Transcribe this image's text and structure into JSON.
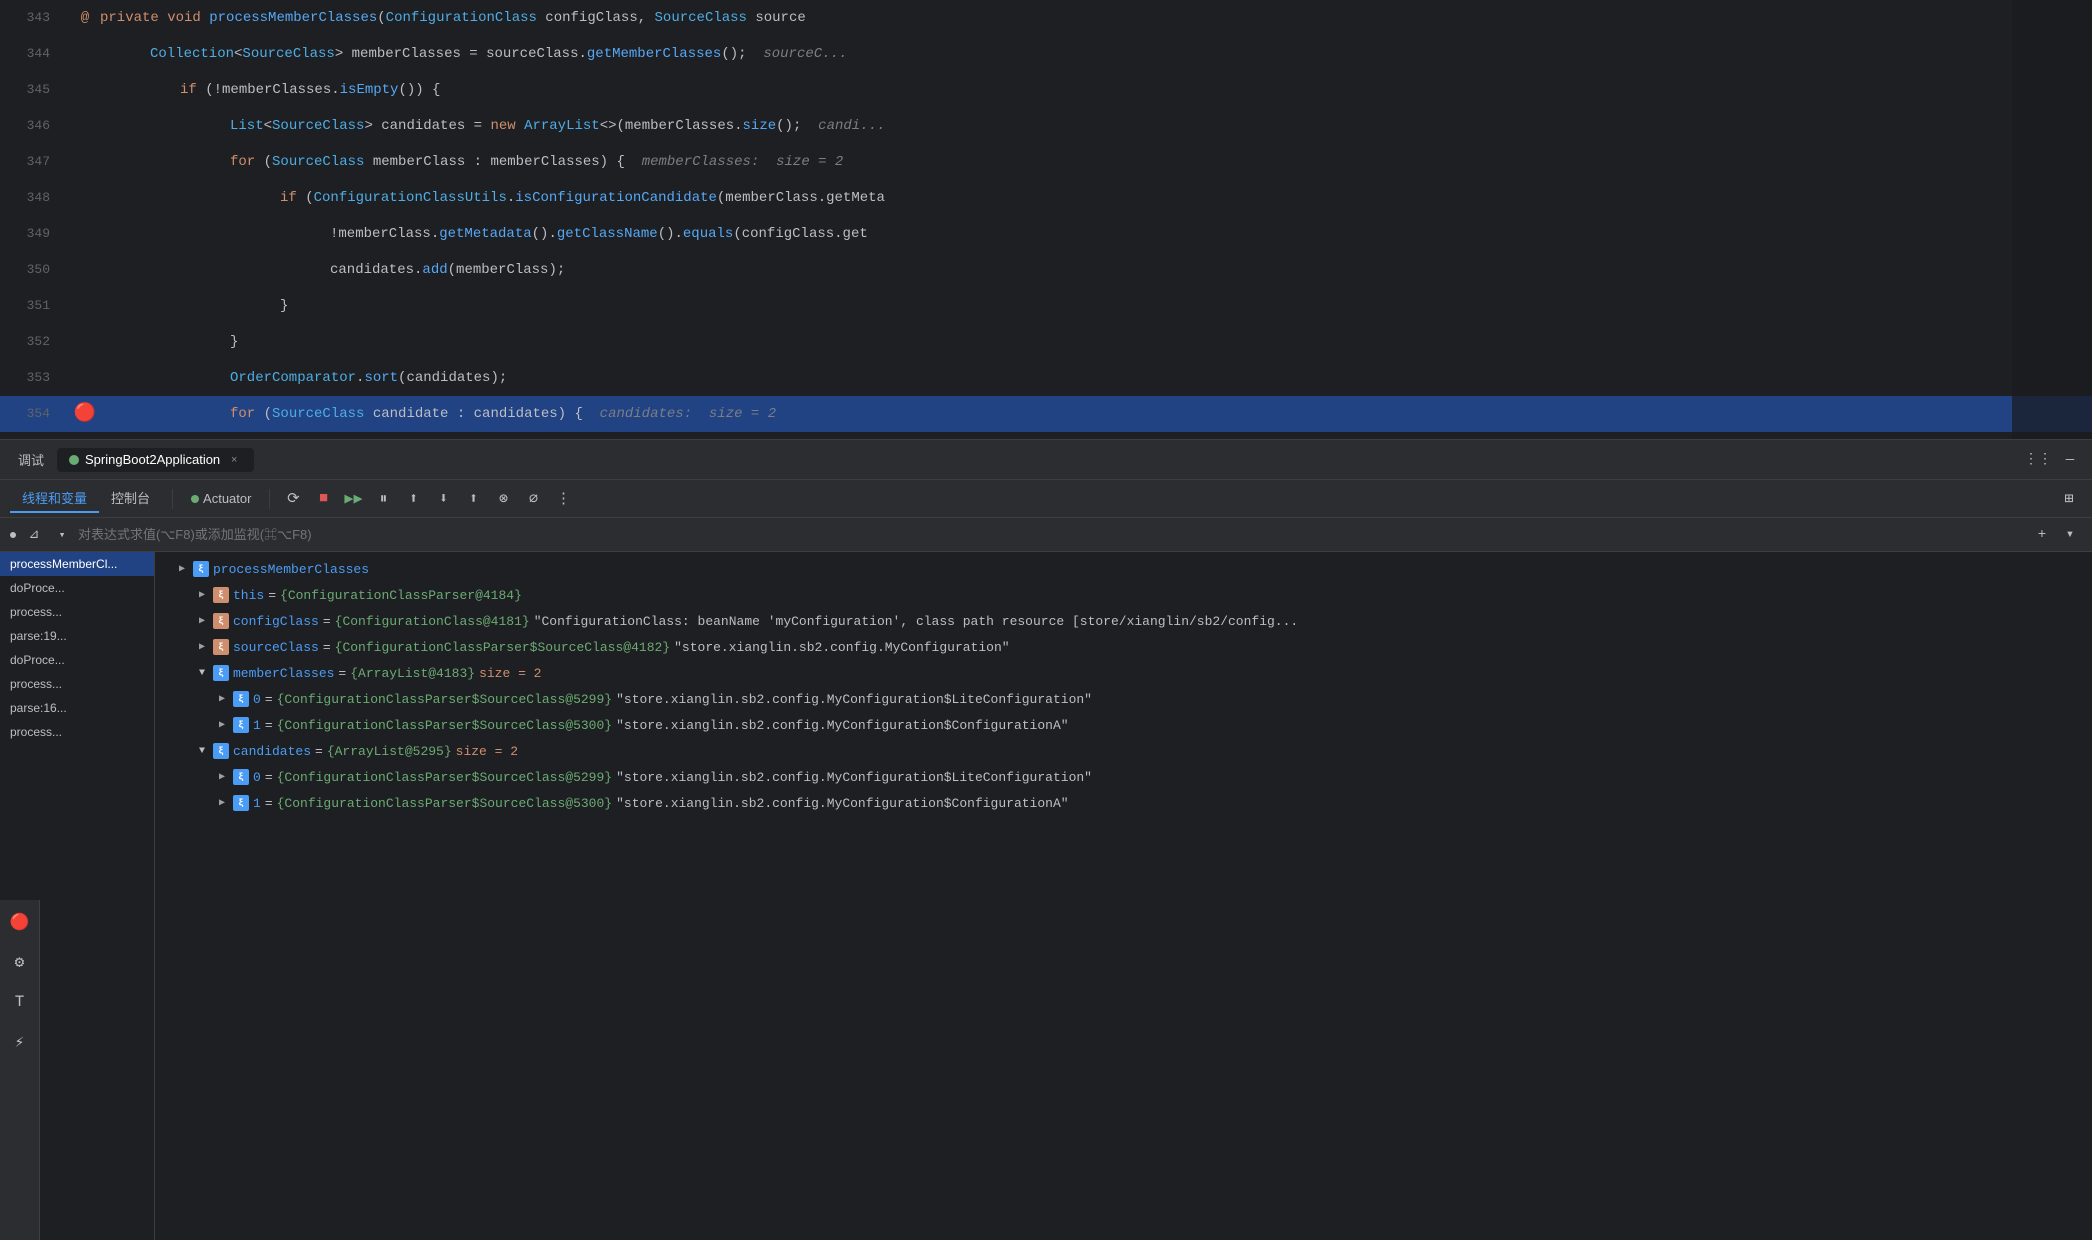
{
  "editor": {
    "lines": [
      {
        "number": "343",
        "gutter": "@",
        "content": [
          {
            "type": "kw",
            "text": "private "
          },
          {
            "type": "kw",
            "text": "void "
          },
          {
            "type": "fn",
            "text": "processMemberClasses"
          },
          {
            "type": "punct",
            "text": "("
          },
          {
            "type": "type",
            "text": "ConfigurationClass"
          },
          {
            "type": "var",
            "text": " configClass, "
          },
          {
            "type": "type",
            "text": "SourceClass"
          },
          {
            "type": "var",
            "text": " source"
          }
        ],
        "highlighted": false
      },
      {
        "number": "344",
        "gutter": "",
        "content": [
          {
            "type": "type",
            "text": "Collection"
          },
          {
            "type": "punct",
            "text": "<"
          },
          {
            "type": "type",
            "text": "SourceClass"
          },
          {
            "type": "punct",
            "text": ">"
          },
          {
            "type": "var",
            "text": " memberClasses = sourceClass."
          },
          {
            "type": "fn",
            "text": "getMemberClasses"
          },
          {
            "type": "punct",
            "text": "();"
          },
          {
            "type": "hint",
            "text": "    sourceC..."
          }
        ],
        "highlighted": false
      },
      {
        "number": "345",
        "gutter": "",
        "content": [
          {
            "type": "kw",
            "text": "if "
          },
          {
            "type": "punct",
            "text": "(!memberClasses."
          },
          {
            "type": "fn",
            "text": "isEmpty"
          },
          {
            "type": "punct",
            "text": "()) {"
          }
        ],
        "highlighted": false
      },
      {
        "number": "346",
        "gutter": "",
        "content": [
          {
            "type": "type",
            "text": "List"
          },
          {
            "type": "punct",
            "text": "<"
          },
          {
            "type": "type",
            "text": "SourceClass"
          },
          {
            "type": "punct",
            "text": ">"
          },
          {
            "type": "var",
            "text": " candidates = "
          },
          {
            "type": "kw",
            "text": "new "
          },
          {
            "type": "type",
            "text": "ArrayList"
          },
          {
            "type": "punct",
            "text": "<>(memberClasses."
          },
          {
            "type": "fn",
            "text": "size"
          },
          {
            "type": "punct",
            "text": "());"
          },
          {
            "type": "hint",
            "text": "    candi..."
          }
        ],
        "highlighted": false
      },
      {
        "number": "347",
        "gutter": "",
        "content": [
          {
            "type": "kw",
            "text": "for "
          },
          {
            "type": "punct",
            "text": "("
          },
          {
            "type": "type",
            "text": "SourceClass"
          },
          {
            "type": "var",
            "text": " memberClass : memberClasses) {"
          },
          {
            "type": "hint",
            "text": "  memberClasses:  size = 2"
          }
        ],
        "highlighted": false
      },
      {
        "number": "348",
        "gutter": "",
        "content": [
          {
            "type": "kw",
            "text": "if "
          },
          {
            "type": "punct",
            "text": "("
          },
          {
            "type": "type",
            "text": "ConfigurationClassUtils"
          },
          {
            "type": "punct",
            "text": "."
          },
          {
            "type": "fn",
            "text": "isConfigurationCandidate"
          },
          {
            "type": "punct",
            "text": "(memberClass.getMeta"
          }
        ],
        "highlighted": false
      },
      {
        "number": "349",
        "gutter": "",
        "content": [
          {
            "type": "var",
            "text": "!memberClass."
          },
          {
            "type": "fn",
            "text": "getMetadata"
          },
          {
            "type": "punct",
            "text": "()."
          },
          {
            "type": "fn",
            "text": "getClassName"
          },
          {
            "type": "punct",
            "text": "()."
          },
          {
            "type": "fn",
            "text": "equals"
          },
          {
            "type": "punct",
            "text": "(configClass.get"
          }
        ],
        "highlighted": false
      },
      {
        "number": "350",
        "gutter": "",
        "content": [
          {
            "type": "var",
            "text": "candidates."
          },
          {
            "type": "fn",
            "text": "add"
          },
          {
            "type": "punct",
            "text": "(memberClass);"
          }
        ],
        "highlighted": false
      },
      {
        "number": "351",
        "gutter": "",
        "content": [
          {
            "type": "punct",
            "text": "}"
          }
        ],
        "highlighted": false
      },
      {
        "number": "352",
        "gutter": "",
        "content": [
          {
            "type": "punct",
            "text": "}"
          }
        ],
        "highlighted": false
      },
      {
        "number": "353",
        "gutter": "",
        "content": [
          {
            "type": "type",
            "text": "OrderComparator"
          },
          {
            "type": "punct",
            "text": "."
          },
          {
            "type": "fn",
            "text": "sort"
          },
          {
            "type": "punct",
            "text": "(candidates);"
          }
        ],
        "highlighted": false
      },
      {
        "number": "354",
        "gutter": "●",
        "content": [
          {
            "type": "kw",
            "text": "for "
          },
          {
            "type": "punct",
            "text": "("
          },
          {
            "type": "type",
            "text": "SourceClass"
          },
          {
            "type": "var",
            "text": " candidate : candidates) {"
          },
          {
            "type": "hint",
            "text": "  candidates:  size = 2"
          }
        ],
        "highlighted": true
      }
    ]
  },
  "debug": {
    "tab_label": "调试",
    "app_tab_label": "SpringBoot2Application",
    "close_label": "×",
    "toolbar": {
      "threads_vars_label": "线程和变量",
      "console_label": "控制台",
      "actuator_label": "Actuator",
      "buttons": [
        "⟳",
        "■",
        "▶▶",
        "⏸",
        "⬆",
        "⬇",
        "⬆",
        "⊗",
        "∅",
        "⋮"
      ]
    },
    "filter_placeholder": "对表达式求值(⌥F8)或添加监视(⌘⌥F8)",
    "variables": [
      {
        "indent": 0,
        "expanded": false,
        "icon": "blue",
        "name": "processMemberClasses",
        "truncated": true
      },
      {
        "indent": 0,
        "expanded": false,
        "icon": "orange",
        "name": "this",
        "eq": " = ",
        "ref": "{ConfigurationClassParser@4184}"
      },
      {
        "indent": 0,
        "expanded": false,
        "icon": "orange",
        "name": "configClass",
        "eq": " = ",
        "ref": "{ConfigurationClass@4181}",
        "val": " \"ConfigurationClass: beanName 'myConfiguration', class path resource [store/xianglin/sb2/config..."
      },
      {
        "indent": 0,
        "expanded": false,
        "icon": "orange",
        "name": "sourceClass",
        "eq": " = ",
        "ref": "{ConfigurationClassParser$SourceClass@4182}",
        "val": " \"store.xianglin.sb2.config.MyConfiguration\""
      },
      {
        "indent": 0,
        "expanded": true,
        "icon": "blue",
        "name": "memberClasses",
        "eq": " = ",
        "ref": "{ArrayList@4183}",
        "size": " size = 2"
      },
      {
        "indent": 1,
        "expanded": false,
        "icon": "blue",
        "name": "0",
        "eq": " = ",
        "ref": "{ConfigurationClassParser$SourceClass@5299}",
        "val": " \"store.xianglin.sb2.config.MyConfiguration$LiteConfiguration\""
      },
      {
        "indent": 1,
        "expanded": false,
        "icon": "blue",
        "name": "1",
        "eq": " = ",
        "ref": "{ConfigurationClassParser$SourceClass@5300}",
        "val": " \"store.xianglin.sb2.config.MyConfiguration$ConfigurationA\""
      },
      {
        "indent": 0,
        "expanded": true,
        "icon": "blue",
        "name": "candidates",
        "eq": " = ",
        "ref": "{ArrayList@5295}",
        "size": " size = 2"
      },
      {
        "indent": 1,
        "expanded": false,
        "icon": "blue",
        "name": "0",
        "eq": " = ",
        "ref": "{ConfigurationClassParser$SourceClass@5299}",
        "val": " \"store.xianglin.sb2.config.MyConfiguration$LiteConfiguration\""
      },
      {
        "indent": 1,
        "expanded": false,
        "icon": "blue",
        "name": "1",
        "eq": " = ",
        "ref": "{ConfigurationClassParser$SourceClass@5300}",
        "val": " \"store.xianglin.sb2.config.MyConfiguration$ConfigurationA\""
      }
    ],
    "call_stack": [
      {
        "label": "processMemberCl...",
        "active": true
      },
      {
        "label": "doProce..."
      },
      {
        "label": "process..."
      },
      {
        "label": "parse:19..."
      },
      {
        "label": "doProce..."
      },
      {
        "label": "process..."
      },
      {
        "label": "parse:16..."
      },
      {
        "label": "process..."
      }
    ]
  },
  "sidebar": {
    "icons": [
      "🔴",
      "⚙",
      "T",
      "⚡"
    ]
  }
}
